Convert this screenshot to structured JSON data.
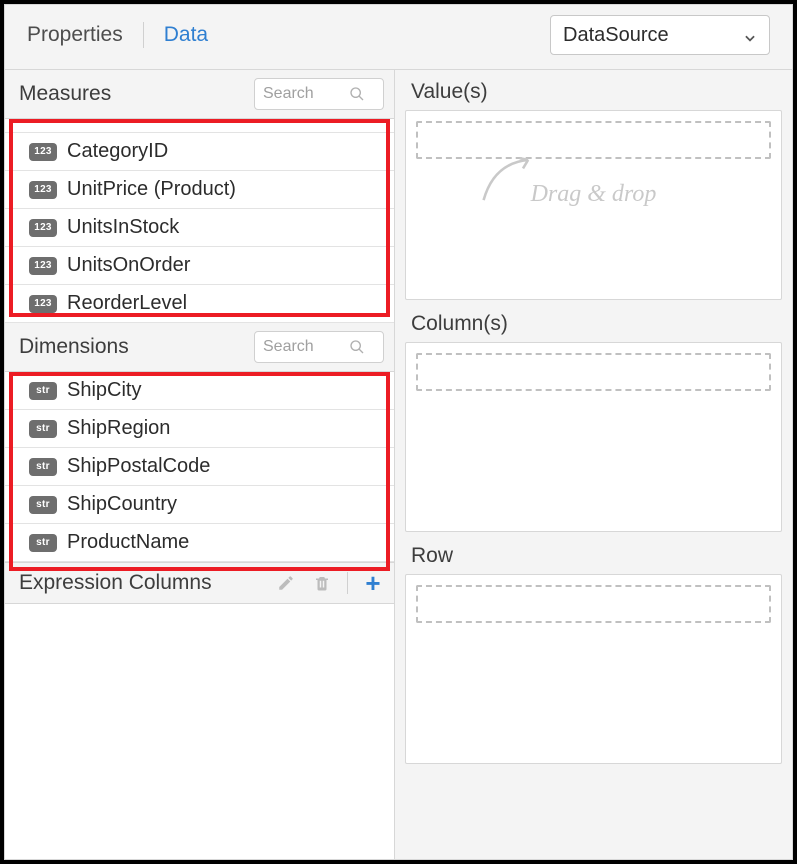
{
  "tabs": {
    "properties": "Properties",
    "data": "Data"
  },
  "datasource": {
    "label": "DataSource"
  },
  "measures": {
    "title": "Measures",
    "search_placeholder": "Search",
    "items": [
      {
        "type": "num",
        "label": "CategoryID"
      },
      {
        "type": "num",
        "label": "UnitPrice (Product)"
      },
      {
        "type": "num",
        "label": "UnitsInStock"
      },
      {
        "type": "num",
        "label": "UnitsOnOrder"
      },
      {
        "type": "num",
        "label": "ReorderLevel"
      }
    ]
  },
  "dimensions": {
    "title": "Dimensions",
    "search_placeholder": "Search",
    "items": [
      {
        "type": "str",
        "label": "ShipCity"
      },
      {
        "type": "str",
        "label": "ShipRegion"
      },
      {
        "type": "str",
        "label": "ShipPostalCode"
      },
      {
        "type": "str",
        "label": "ShipCountry"
      },
      {
        "type": "str",
        "label": "ProductName"
      }
    ]
  },
  "expression": {
    "title": "Expression Columns"
  },
  "dropzones": {
    "values": "Value(s)",
    "columns": "Column(s)",
    "row": "Row",
    "hint": "Drag & drop"
  }
}
